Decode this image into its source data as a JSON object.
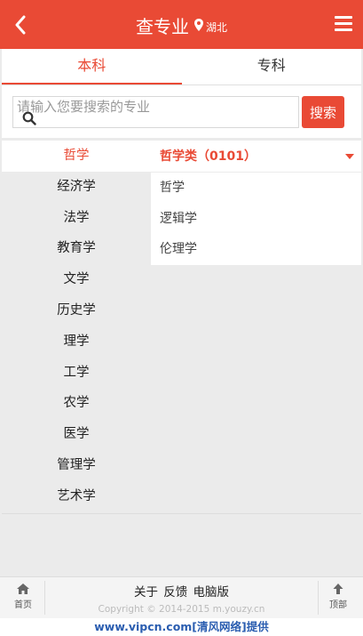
{
  "header": {
    "title": "查专业",
    "location": "湖北",
    "bg_color": "#e94a35"
  },
  "tabs": [
    {
      "label": "本科",
      "active": true
    },
    {
      "label": "专科",
      "active": false
    }
  ],
  "search": {
    "placeholder": "请输入您要搜索的专业",
    "button_label": "搜索"
  },
  "categories": [
    {
      "label": "哲学",
      "active": true
    },
    {
      "label": "经济学"
    },
    {
      "label": "法学"
    },
    {
      "label": "教育学"
    },
    {
      "label": "文学"
    },
    {
      "label": "历史学"
    },
    {
      "label": "理学"
    },
    {
      "label": "工学"
    },
    {
      "label": "农学"
    },
    {
      "label": "医学"
    },
    {
      "label": "管理学"
    },
    {
      "label": "艺术学"
    }
  ],
  "subcategory": {
    "title": "哲学类（0101）",
    "majors": [
      "哲学",
      "逻辑学",
      "伦理学"
    ]
  },
  "footer": {
    "home_label": "首页",
    "top_label": "顶部",
    "links": [
      "关于",
      "反馈",
      "电脑版"
    ],
    "copyright": "Copyright © 2014-2015 m.youzy.cn"
  },
  "watermark": "www.vipcn.com[清风网络]提供"
}
